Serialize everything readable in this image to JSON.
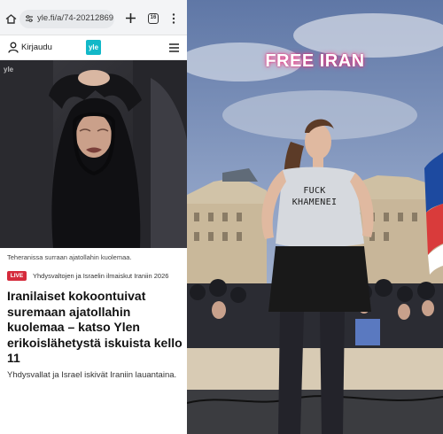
{
  "browser": {
    "url": "yle.fi/a/74-20212869",
    "tabs_count": "16"
  },
  "site_header": {
    "login_label": "Kirjaudu",
    "logo_text": "yle"
  },
  "photo": {
    "watermark": "yle"
  },
  "article": {
    "image_caption": "Teheranissa surraan ajatollahin kuolemaa.",
    "live_badge": "LIVE",
    "topic": "Yhdysvaltojen ja Israelin ilmaiskut Iraniin 2026",
    "headline": "Iranilaiset kokoontuivat suremaan ajatollahin kuolemaa – katso Ylen erikoislähetystä iskuista kello 11",
    "lead": "Yhdysvallat ja Israel iskivät Iraniin lauantaina."
  },
  "protest_image": {
    "overlay_text": "FREE IRAN",
    "shirt_text": "FUCK KHAMENEI"
  },
  "colors": {
    "logo": "#12b8c8",
    "live_badge": "#d52b3c",
    "overlay_glow": "#ff3f8e"
  }
}
